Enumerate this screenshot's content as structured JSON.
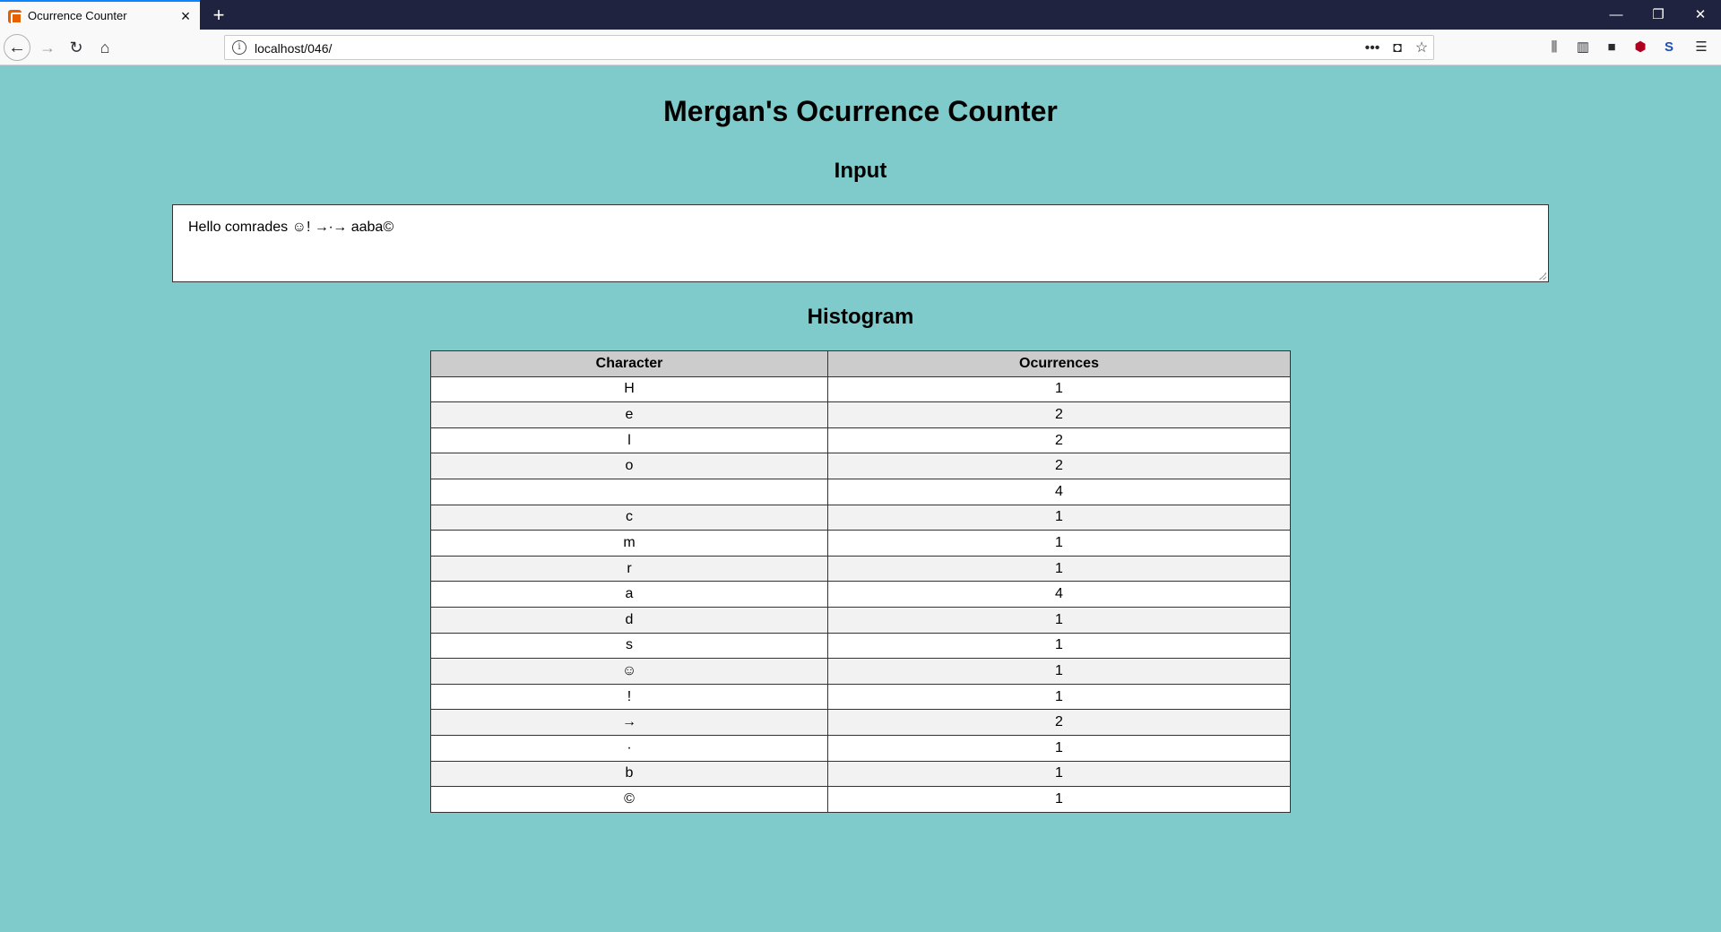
{
  "browser": {
    "tab_title": "Ocurrence Counter",
    "url": "localhost/046/"
  },
  "page": {
    "title": "Mergan's Ocurrence Counter",
    "input_heading": "Input",
    "input_value": "Hello comrades ☺! →∙→ aaba©",
    "histogram_heading": "Histogram"
  },
  "table": {
    "headers": [
      "Character",
      "Ocurrences"
    ],
    "rows": [
      {
        "char": "H",
        "count": "1"
      },
      {
        "char": "e",
        "count": "2"
      },
      {
        "char": "l",
        "count": "2"
      },
      {
        "char": "o",
        "count": "2"
      },
      {
        "char": " ",
        "count": "4"
      },
      {
        "char": "c",
        "count": "1"
      },
      {
        "char": "m",
        "count": "1"
      },
      {
        "char": "r",
        "count": "1"
      },
      {
        "char": "a",
        "count": "4"
      },
      {
        "char": "d",
        "count": "1"
      },
      {
        "char": "s",
        "count": "1"
      },
      {
        "char": "☺",
        "count": "1"
      },
      {
        "char": "!",
        "count": "1"
      },
      {
        "char": "→",
        "count": "2"
      },
      {
        "char": "∙",
        "count": "1"
      },
      {
        "char": "b",
        "count": "1"
      },
      {
        "char": "©",
        "count": "1"
      }
    ]
  }
}
